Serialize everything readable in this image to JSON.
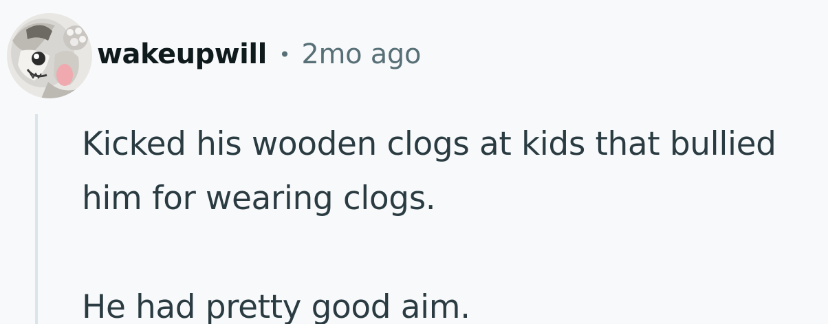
{
  "comment": {
    "author": {
      "username": "wakeupwill",
      "avatar_icon": "cartoon-character-avatar-icon"
    },
    "separator": "•",
    "timestamp": "2mo ago",
    "body": {
      "line1": "Kicked his wooden clogs at kids that bullied",
      "line2": "him for wearing clogs.",
      "line3": "He had pretty good aim."
    }
  },
  "colors": {
    "background": "#f8f9fa",
    "username": "#0f1a1c",
    "meta": "#576f76",
    "body_text": "#2a3c42",
    "thread_line": "#dbe4e9"
  }
}
